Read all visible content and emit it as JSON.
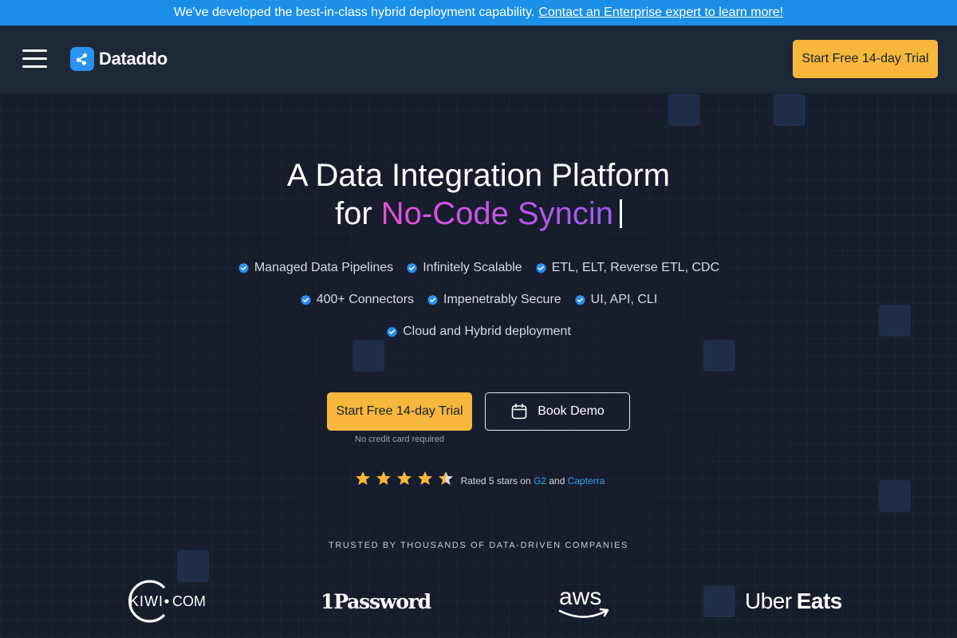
{
  "announcement": {
    "text": "We've developed the best-in-class hybrid deployment capability.",
    "link": "Contact an Enterprise expert to learn more!"
  },
  "nav": {
    "brand": "Dataddo",
    "cta": "Start Free 14-day Trial"
  },
  "hero": {
    "title_line1": "A Data Integration Platform",
    "title_prefix": "for",
    "title_highlight": "No-Code Syncin"
  },
  "features": {
    "row1": [
      "Managed Data Pipelines",
      "Infinitely Scalable",
      "ETL, ELT, Reverse ETL, CDC"
    ],
    "row2": [
      "400+ Connectors",
      "Impenetrably Secure",
      "UI, API, CLI"
    ],
    "row3": [
      "Cloud and Hybrid deployment"
    ]
  },
  "buttons": {
    "primary": "Start Free 14-day Trial",
    "secondary": "Book Demo",
    "note": "No credit card required"
  },
  "rating": {
    "stars": 5,
    "text_before": "Rated 5 stars on",
    "g2": "G2",
    "and": "and",
    "capterra": "Capterra"
  },
  "trusted": {
    "heading": "TRUSTED BY THOUSANDS OF DATA-DRIVEN COMPANIES",
    "logos": {
      "kiwi": "KIWI",
      "kiwi_com": "COM",
      "onepassword": "1Password",
      "aws": "aws",
      "uber": "Uber",
      "eats": "Eats"
    }
  },
  "colors": {
    "announce_bg": "#1a8fe8",
    "nav_bg": "#1e2738",
    "page_bg": "#161d2c",
    "accent_yellow": "#f6b73c",
    "check_blue": "#2b8ff0",
    "gradient_start": "#e84fd8",
    "gradient_end": "#9a5cf4"
  },
  "icons": {
    "menu": "hamburger-icon",
    "logo": "dataddo-logo-icon",
    "check": "verified-check-icon",
    "calendar": "calendar-icon",
    "star": "star-icon"
  }
}
